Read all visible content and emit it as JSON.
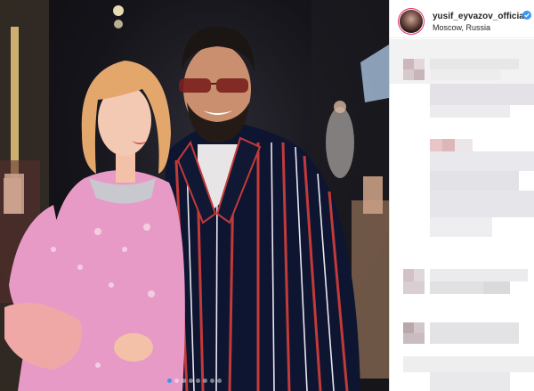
{
  "post": {
    "username": "yusif_eyvazov_official",
    "location": "Moscow, Russia",
    "icons": {
      "avatar": "profile-photo",
      "verified": "verified-badge-icon"
    },
    "carousel": {
      "slides": 8,
      "active_slide": 1
    }
  },
  "colors": {
    "verified": "#3897f0",
    "accent_dot": "#3897f0"
  }
}
